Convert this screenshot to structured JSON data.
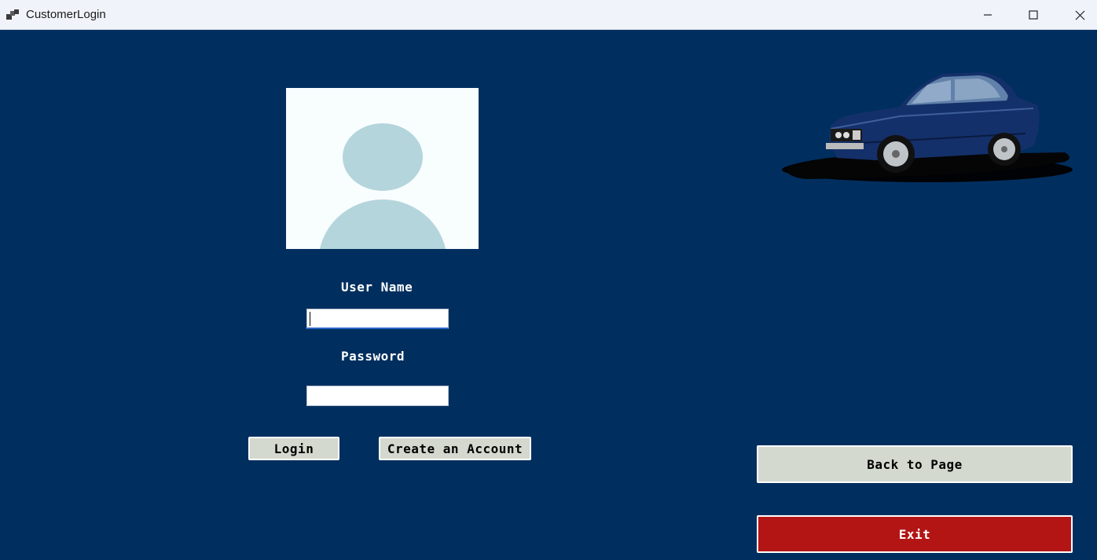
{
  "window": {
    "title": "CustomerLogin"
  },
  "form": {
    "username_label": "User Name",
    "username_value": "",
    "password_label": "Password",
    "password_value": "",
    "login_label": "Login",
    "create_account_label": "Create an Account",
    "back_label": "Back to Page",
    "exit_label": "Exit"
  },
  "colors": {
    "background": "#002f5f",
    "button": "#d4d9cf",
    "exit_button": "#b31515"
  },
  "icons": {
    "avatar": "user-avatar-icon",
    "car": "car-image"
  }
}
